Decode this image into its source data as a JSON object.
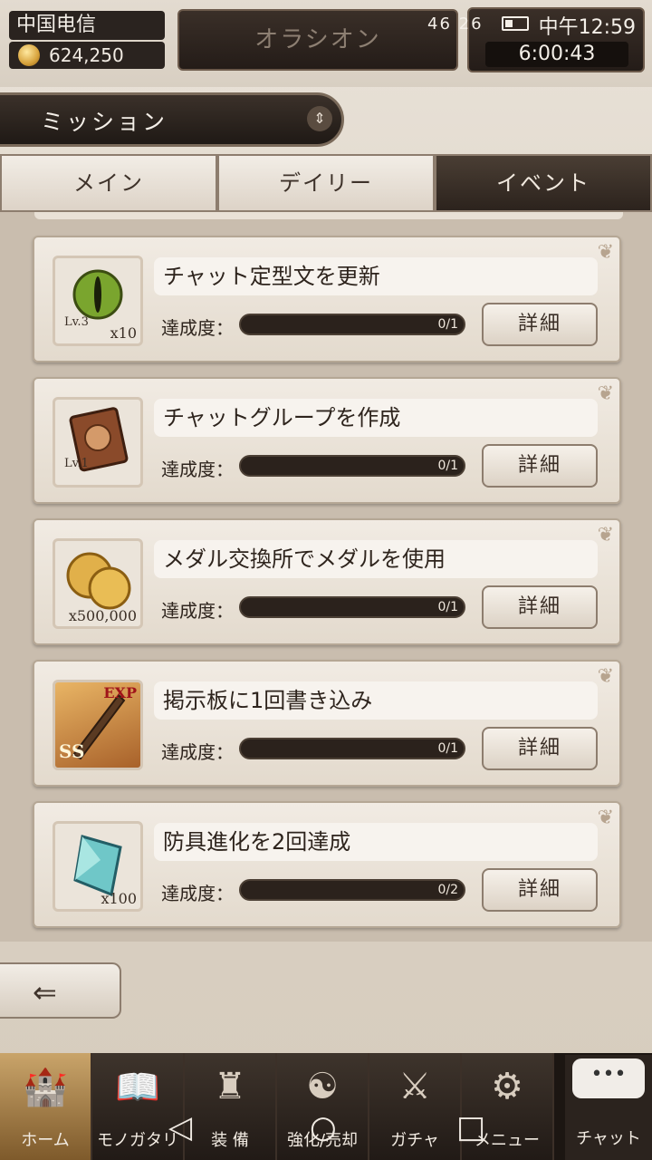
{
  "status_bar": {
    "carrier": "中国电信",
    "signal": "46 26",
    "clock": "中午12:59"
  },
  "header": {
    "gold": "624,250",
    "title": "オラシオン",
    "countdown": "6:00:43"
  },
  "page": {
    "title": "ミッション"
  },
  "tabs": [
    {
      "label": "メイン"
    },
    {
      "label": "デイリー"
    },
    {
      "label": "イベント"
    }
  ],
  "active_tab": "イベント",
  "progress_label": "達成度：",
  "detail_label": "詳細",
  "missions": [
    {
      "title": "チャット定型文を更新",
      "progress": "0/1",
      "fraction": 0,
      "reward_icon": "eye-orb-icon",
      "reward_level": "Lv.3",
      "reward_qty": "x10"
    },
    {
      "title": "チャットグループを作成",
      "progress": "0/1",
      "fraction": 0,
      "reward_icon": "book-icon",
      "reward_level": "Lv.1",
      "reward_qty": ""
    },
    {
      "title": "メダル交換所でメダルを使用",
      "progress": "0/1",
      "fraction": 0,
      "reward_icon": "gold-coins-icon",
      "reward_level": "",
      "reward_qty": "x500,000"
    },
    {
      "title": "掲示板に1回書き込み",
      "progress": "0/1",
      "fraction": 0,
      "reward_icon": "exp-weapon-icon",
      "reward_level": "SS",
      "reward_qty": "EXP"
    },
    {
      "title": "防具進化を2回達成",
      "progress": "0/2",
      "fraction": 0,
      "reward_icon": "crystal-icon",
      "reward_level": "",
      "reward_qty": "x100"
    }
  ],
  "nav": [
    {
      "label": "ホーム",
      "icon": "castle-icon"
    },
    {
      "label": "モノガタリ",
      "icon": "open-book-icon"
    },
    {
      "label": "装 備",
      "icon": "equipment-icon"
    },
    {
      "label": "強化/売却",
      "icon": "dragon-icon"
    },
    {
      "label": "ガチャ",
      "icon": "crossed-swords-icon"
    },
    {
      "label": "メニュー",
      "icon": "gears-icon"
    }
  ],
  "chat": {
    "label": "チャット",
    "bubble": "•••"
  },
  "colors": {
    "background": "#ddd4c7",
    "dark_panel": "#2a231f",
    "accent_gold": "#c59b4c"
  }
}
